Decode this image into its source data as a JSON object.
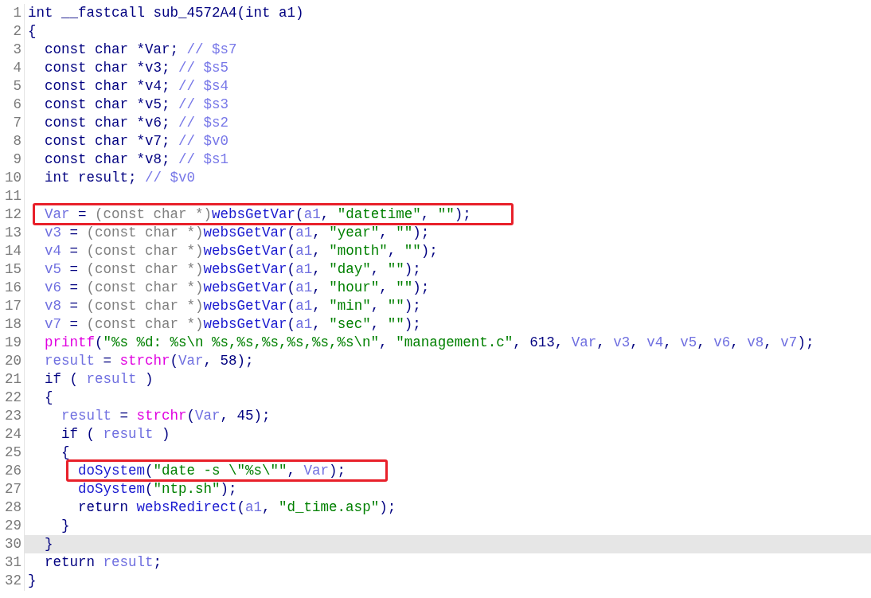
{
  "code_view": {
    "lines": [
      {
        "number": "1",
        "boxed": false,
        "current": false,
        "tokens": [
          {
            "text": "int __fastcall sub_4572A4(int a1)",
            "kind": "plain"
          }
        ]
      },
      {
        "number": "2",
        "boxed": false,
        "current": false,
        "tokens": [
          {
            "text": "{",
            "kind": "plain"
          }
        ]
      },
      {
        "number": "3",
        "boxed": false,
        "current": false,
        "tokens": [
          {
            "text": "  const char *Var; ",
            "kind": "plain"
          },
          {
            "text": "// $s7",
            "kind": "comment"
          }
        ]
      },
      {
        "number": "4",
        "boxed": false,
        "current": false,
        "tokens": [
          {
            "text": "  const char *v3; ",
            "kind": "plain"
          },
          {
            "text": "// $s5",
            "kind": "comment"
          }
        ]
      },
      {
        "number": "5",
        "boxed": false,
        "current": false,
        "tokens": [
          {
            "text": "  const char *v4; ",
            "kind": "plain"
          },
          {
            "text": "// $s4",
            "kind": "comment"
          }
        ]
      },
      {
        "number": "6",
        "boxed": false,
        "current": false,
        "tokens": [
          {
            "text": "  const char *v5; ",
            "kind": "plain"
          },
          {
            "text": "// $s3",
            "kind": "comment"
          }
        ]
      },
      {
        "number": "7",
        "boxed": false,
        "current": false,
        "tokens": [
          {
            "text": "  const char *v6; ",
            "kind": "plain"
          },
          {
            "text": "// $s2",
            "kind": "comment"
          }
        ]
      },
      {
        "number": "8",
        "boxed": false,
        "current": false,
        "tokens": [
          {
            "text": "  const char *v7; ",
            "kind": "plain"
          },
          {
            "text": "// $v0",
            "kind": "comment"
          }
        ]
      },
      {
        "number": "9",
        "boxed": false,
        "current": false,
        "tokens": [
          {
            "text": "  const char *v8; ",
            "kind": "plain"
          },
          {
            "text": "// $s1",
            "kind": "comment"
          }
        ]
      },
      {
        "number": "10",
        "boxed": false,
        "current": false,
        "tokens": [
          {
            "text": "  int result; ",
            "kind": "plain"
          },
          {
            "text": "// $v0",
            "kind": "comment"
          }
        ]
      },
      {
        "number": "11",
        "boxed": false,
        "current": false
      },
      {
        "number": "12",
        "boxed": true,
        "current": false,
        "tokens": [
          {
            "text": "  Var",
            "kind": "var"
          },
          {
            "text": " = ",
            "kind": "plain"
          },
          {
            "text": "(const char *)",
            "kind": "cast"
          },
          {
            "text": "websGetVar",
            "kind": "func"
          },
          {
            "text": "(",
            "kind": "plain"
          },
          {
            "text": "a1",
            "kind": "var"
          },
          {
            "text": ", ",
            "kind": "plain"
          },
          {
            "text": "\"datetime\"",
            "kind": "string"
          },
          {
            "text": ", ",
            "kind": "plain"
          },
          {
            "text": "\"\"",
            "kind": "string"
          },
          {
            "text": ");",
            "kind": "plain"
          }
        ]
      },
      {
        "number": "13",
        "boxed": false,
        "current": false,
        "tokens": [
          {
            "text": "  v3",
            "kind": "var"
          },
          {
            "text": " = ",
            "kind": "plain"
          },
          {
            "text": "(const char *)",
            "kind": "cast"
          },
          {
            "text": "websGetVar",
            "kind": "func"
          },
          {
            "text": "(",
            "kind": "plain"
          },
          {
            "text": "a1",
            "kind": "var"
          },
          {
            "text": ", ",
            "kind": "plain"
          },
          {
            "text": "\"year\"",
            "kind": "string"
          },
          {
            "text": ", ",
            "kind": "plain"
          },
          {
            "text": "\"\"",
            "kind": "string"
          },
          {
            "text": ");",
            "kind": "plain"
          }
        ]
      },
      {
        "number": "14",
        "boxed": false,
        "current": false,
        "tokens": [
          {
            "text": "  v4",
            "kind": "var"
          },
          {
            "text": " = ",
            "kind": "plain"
          },
          {
            "text": "(const char *)",
            "kind": "cast"
          },
          {
            "text": "websGetVar",
            "kind": "func"
          },
          {
            "text": "(",
            "kind": "plain"
          },
          {
            "text": "a1",
            "kind": "var"
          },
          {
            "text": ", ",
            "kind": "plain"
          },
          {
            "text": "\"month\"",
            "kind": "string"
          },
          {
            "text": ", ",
            "kind": "plain"
          },
          {
            "text": "\"\"",
            "kind": "string"
          },
          {
            "text": ");",
            "kind": "plain"
          }
        ]
      },
      {
        "number": "15",
        "boxed": false,
        "current": false,
        "tokens": [
          {
            "text": "  v5",
            "kind": "var"
          },
          {
            "text": " = ",
            "kind": "plain"
          },
          {
            "text": "(const char *)",
            "kind": "cast"
          },
          {
            "text": "websGetVar",
            "kind": "func"
          },
          {
            "text": "(",
            "kind": "plain"
          },
          {
            "text": "a1",
            "kind": "var"
          },
          {
            "text": ", ",
            "kind": "plain"
          },
          {
            "text": "\"day\"",
            "kind": "string"
          },
          {
            "text": ", ",
            "kind": "plain"
          },
          {
            "text": "\"\"",
            "kind": "string"
          },
          {
            "text": ");",
            "kind": "plain"
          }
        ]
      },
      {
        "number": "16",
        "boxed": false,
        "current": false,
        "tokens": [
          {
            "text": "  v6",
            "kind": "var"
          },
          {
            "text": " = ",
            "kind": "plain"
          },
          {
            "text": "(const char *)",
            "kind": "cast"
          },
          {
            "text": "websGetVar",
            "kind": "func"
          },
          {
            "text": "(",
            "kind": "plain"
          },
          {
            "text": "a1",
            "kind": "var"
          },
          {
            "text": ", ",
            "kind": "plain"
          },
          {
            "text": "\"hour\"",
            "kind": "string"
          },
          {
            "text": ", ",
            "kind": "plain"
          },
          {
            "text": "\"\"",
            "kind": "string"
          },
          {
            "text": ");",
            "kind": "plain"
          }
        ]
      },
      {
        "number": "17",
        "boxed": false,
        "current": false,
        "tokens": [
          {
            "text": "  v8",
            "kind": "var"
          },
          {
            "text": " = ",
            "kind": "plain"
          },
          {
            "text": "(const char *)",
            "kind": "cast"
          },
          {
            "text": "websGetVar",
            "kind": "func"
          },
          {
            "text": "(",
            "kind": "plain"
          },
          {
            "text": "a1",
            "kind": "var"
          },
          {
            "text": ", ",
            "kind": "plain"
          },
          {
            "text": "\"min\"",
            "kind": "string"
          },
          {
            "text": ", ",
            "kind": "plain"
          },
          {
            "text": "\"\"",
            "kind": "string"
          },
          {
            "text": ");",
            "kind": "plain"
          }
        ]
      },
      {
        "number": "18",
        "boxed": false,
        "current": false,
        "tokens": [
          {
            "text": "  v7",
            "kind": "var"
          },
          {
            "text": " = ",
            "kind": "plain"
          },
          {
            "text": "(const char *)",
            "kind": "cast"
          },
          {
            "text": "websGetVar",
            "kind": "func"
          },
          {
            "text": "(",
            "kind": "plain"
          },
          {
            "text": "a1",
            "kind": "var"
          },
          {
            "text": ", ",
            "kind": "plain"
          },
          {
            "text": "\"sec\"",
            "kind": "string"
          },
          {
            "text": ", ",
            "kind": "plain"
          },
          {
            "text": "\"\"",
            "kind": "string"
          },
          {
            "text": ");",
            "kind": "plain"
          }
        ]
      },
      {
        "number": "19",
        "boxed": false,
        "current": false,
        "tokens": [
          {
            "text": "  printf",
            "kind": "libfunc"
          },
          {
            "text": "(",
            "kind": "plain"
          },
          {
            "text": "\"%s %d: %s\\n %s,%s,%s,%s,%s,%s\\n\"",
            "kind": "string"
          },
          {
            "text": ", ",
            "kind": "plain"
          },
          {
            "text": "\"management.c\"",
            "kind": "string"
          },
          {
            "text": ", 613, ",
            "kind": "plain"
          },
          {
            "text": "Var",
            "kind": "var"
          },
          {
            "text": ", ",
            "kind": "plain"
          },
          {
            "text": "v3",
            "kind": "var"
          },
          {
            "text": ", ",
            "kind": "plain"
          },
          {
            "text": "v4",
            "kind": "var"
          },
          {
            "text": ", ",
            "kind": "plain"
          },
          {
            "text": "v5",
            "kind": "var"
          },
          {
            "text": ", ",
            "kind": "plain"
          },
          {
            "text": "v6",
            "kind": "var"
          },
          {
            "text": ", ",
            "kind": "plain"
          },
          {
            "text": "v8",
            "kind": "var"
          },
          {
            "text": ", ",
            "kind": "plain"
          },
          {
            "text": "v7",
            "kind": "var"
          },
          {
            "text": ");",
            "kind": "plain"
          }
        ]
      },
      {
        "number": "20",
        "boxed": false,
        "current": false,
        "tokens": [
          {
            "text": "  result",
            "kind": "var"
          },
          {
            "text": " = ",
            "kind": "plain"
          },
          {
            "text": "strchr",
            "kind": "libfunc"
          },
          {
            "text": "(",
            "kind": "plain"
          },
          {
            "text": "Var",
            "kind": "var"
          },
          {
            "text": ", 58);",
            "kind": "plain"
          }
        ]
      },
      {
        "number": "21",
        "boxed": false,
        "current": false,
        "tokens": [
          {
            "text": "  if ( ",
            "kind": "plain"
          },
          {
            "text": "result",
            "kind": "var"
          },
          {
            "text": " )",
            "kind": "plain"
          }
        ]
      },
      {
        "number": "22",
        "boxed": false,
        "current": false,
        "tokens": [
          {
            "text": "  {",
            "kind": "plain"
          }
        ]
      },
      {
        "number": "23",
        "boxed": false,
        "current": false,
        "tokens": [
          {
            "text": "    result",
            "kind": "var"
          },
          {
            "text": " = ",
            "kind": "plain"
          },
          {
            "text": "strchr",
            "kind": "libfunc"
          },
          {
            "text": "(",
            "kind": "plain"
          },
          {
            "text": "Var",
            "kind": "var"
          },
          {
            "text": ", 45);",
            "kind": "plain"
          }
        ]
      },
      {
        "number": "24",
        "boxed": false,
        "current": false,
        "tokens": [
          {
            "text": "    if ( ",
            "kind": "plain"
          },
          {
            "text": "result",
            "kind": "var"
          },
          {
            "text": " )",
            "kind": "plain"
          }
        ]
      },
      {
        "number": "25",
        "boxed": false,
        "current": false,
        "tokens": [
          {
            "text": "    {",
            "kind": "plain"
          }
        ]
      },
      {
        "number": "26",
        "boxed": true,
        "current": false,
        "tokens": [
          {
            "text": "      doSystem",
            "kind": "func"
          },
          {
            "text": "(",
            "kind": "plain"
          },
          {
            "text": "\"date -s \\\"%s\\\"\"",
            "kind": "string"
          },
          {
            "text": ", ",
            "kind": "plain"
          },
          {
            "text": "Var",
            "kind": "var"
          },
          {
            "text": ");",
            "kind": "plain"
          }
        ]
      },
      {
        "number": "27",
        "boxed": false,
        "current": false,
        "tokens": [
          {
            "text": "      doSystem",
            "kind": "func"
          },
          {
            "text": "(",
            "kind": "plain"
          },
          {
            "text": "\"ntp.sh\"",
            "kind": "string"
          },
          {
            "text": ");",
            "kind": "plain"
          }
        ]
      },
      {
        "number": "28",
        "boxed": false,
        "current": false,
        "tokens": [
          {
            "text": "      return ",
            "kind": "plain"
          },
          {
            "text": "websRedirect",
            "kind": "func"
          },
          {
            "text": "(",
            "kind": "plain"
          },
          {
            "text": "a1",
            "kind": "var"
          },
          {
            "text": ", ",
            "kind": "plain"
          },
          {
            "text": "\"d_time.asp\"",
            "kind": "string"
          },
          {
            "text": ");",
            "kind": "plain"
          }
        ]
      },
      {
        "number": "29",
        "boxed": false,
        "current": false,
        "tokens": [
          {
            "text": "    }",
            "kind": "plain"
          }
        ]
      },
      {
        "number": "30",
        "boxed": false,
        "current": true,
        "tokens": [
          {
            "text": "  }",
            "kind": "plain"
          }
        ]
      },
      {
        "number": "31",
        "boxed": false,
        "current": false,
        "tokens": [
          {
            "text": "  return ",
            "kind": "plain"
          },
          {
            "text": "result",
            "kind": "var"
          },
          {
            "text": ";",
            "kind": "plain"
          }
        ]
      },
      {
        "number": "32",
        "boxed": false,
        "current": false,
        "tokens": [
          {
            "text": "}",
            "kind": "plain"
          }
        ]
      }
    ]
  }
}
